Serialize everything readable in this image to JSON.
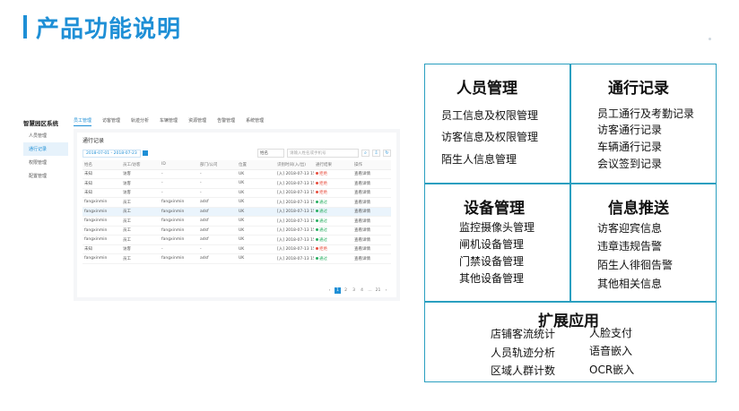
{
  "page": {
    "title": "产品功能说明",
    "accent_color": "#1e8fd6",
    "border_color": "#2a9fc0"
  },
  "screenshot": {
    "logo": "智慧园区系统",
    "nav": [
      "员工管理",
      "访客管理",
      "轨迹分析",
      "车辆管理",
      "资源管理",
      "告警管理",
      "系统管理"
    ],
    "nav_active": 0,
    "sidebar": [
      "人员管理",
      "通行记录",
      "权限管理",
      "配置管理"
    ],
    "sidebar_active": 1,
    "card_title": "通行记录",
    "date_range": "2018-07-01 - 2018-07-23",
    "search_select": "姓名",
    "search_placeholder": "请输入姓名或手机号",
    "columns": [
      "姓名",
      "员工/访客",
      "ID",
      "部门/公司",
      "位置",
      "识别时间(入/出)",
      "通行结果",
      "操作"
    ],
    "rows": [
      [
        "未知",
        "访客",
        "-",
        "-",
        "UK",
        "[入] 2018-07-13 15:24:17",
        "拒绝",
        "查看详情"
      ],
      [
        "未知",
        "访客",
        "-",
        "-",
        "UK",
        "[入] 2018-07-13 15:24:16",
        "拒绝",
        "查看详情"
      ],
      [
        "未知",
        "访客",
        "-",
        "-",
        "UK",
        "[入] 2018-07-13 15:24:15",
        "拒绝",
        "查看详情"
      ],
      [
        "fangxinmin",
        "员工",
        "fangxinmin",
        "adsf",
        "UK",
        "[入] 2018-07-13 15:24:12",
        "通过",
        "查看详情"
      ],
      [
        "fangxinmin",
        "员工",
        "fangxinmin",
        "adsf",
        "UK",
        "[入] 2018-07-13 15:24:08",
        "通过",
        "查看详情"
      ],
      [
        "fangxinmin",
        "员工",
        "fangxinmin",
        "adsf",
        "UK",
        "[入] 2018-07-13 15:23:51",
        "通过",
        "查看详情"
      ],
      [
        "fangxinmin",
        "员工",
        "fangxinmin",
        "adsf",
        "UK",
        "[入] 2018-07-13 15:23:11",
        "通过",
        "查看详情"
      ],
      [
        "fangxinmin",
        "员工",
        "fangxinmin",
        "adsf",
        "UK",
        "[入] 2018-07-13 15:23:08",
        "通过",
        "查看详情"
      ],
      [
        "未知",
        "访客",
        "-",
        "-",
        "UK",
        "[入] 2018-07-13 15:23:01",
        "拒绝",
        "查看详情"
      ],
      [
        "fangxinmin",
        "员工",
        "fangxinmin",
        "adsf",
        "UK",
        "[入] 2018-07-13 15:22:47",
        "通过",
        "查看详情"
      ]
    ],
    "highlighted_row": 4,
    "result_colors": {
      "通过": "#27ae60",
      "拒绝": "#e74c3c"
    },
    "pager": [
      "‹",
      "1",
      "2",
      "3",
      "4",
      "…",
      "21",
      "›"
    ],
    "pager_active": 1
  },
  "features": {
    "personnel": {
      "title": "人员管理",
      "items": [
        "员工信息及权限管理",
        "访客信息及权限管理",
        "陌生人信息管理"
      ]
    },
    "access": {
      "title": "通行记录",
      "items": [
        "员工通行及考勤记录",
        "访客通行记录",
        "车辆通行记录",
        "会议签到记录"
      ]
    },
    "devices": {
      "title": "设备管理",
      "items": [
        "监控摄像头管理",
        "闸机设备管理",
        "门禁设备管理",
        "其他设备管理"
      ]
    },
    "push": {
      "title": "信息推送",
      "items": [
        "访客迎宾信息",
        "违章违规告警",
        "陌生人徘徊告警",
        "其他相关信息"
      ]
    },
    "extension": {
      "title": "扩展应用",
      "left_items": [
        "店铺客流统计",
        "人员轨迹分析",
        "区域人群计数"
      ],
      "right_items": [
        "人脸支付",
        "语音嵌入",
        "OCR嵌入"
      ]
    }
  }
}
